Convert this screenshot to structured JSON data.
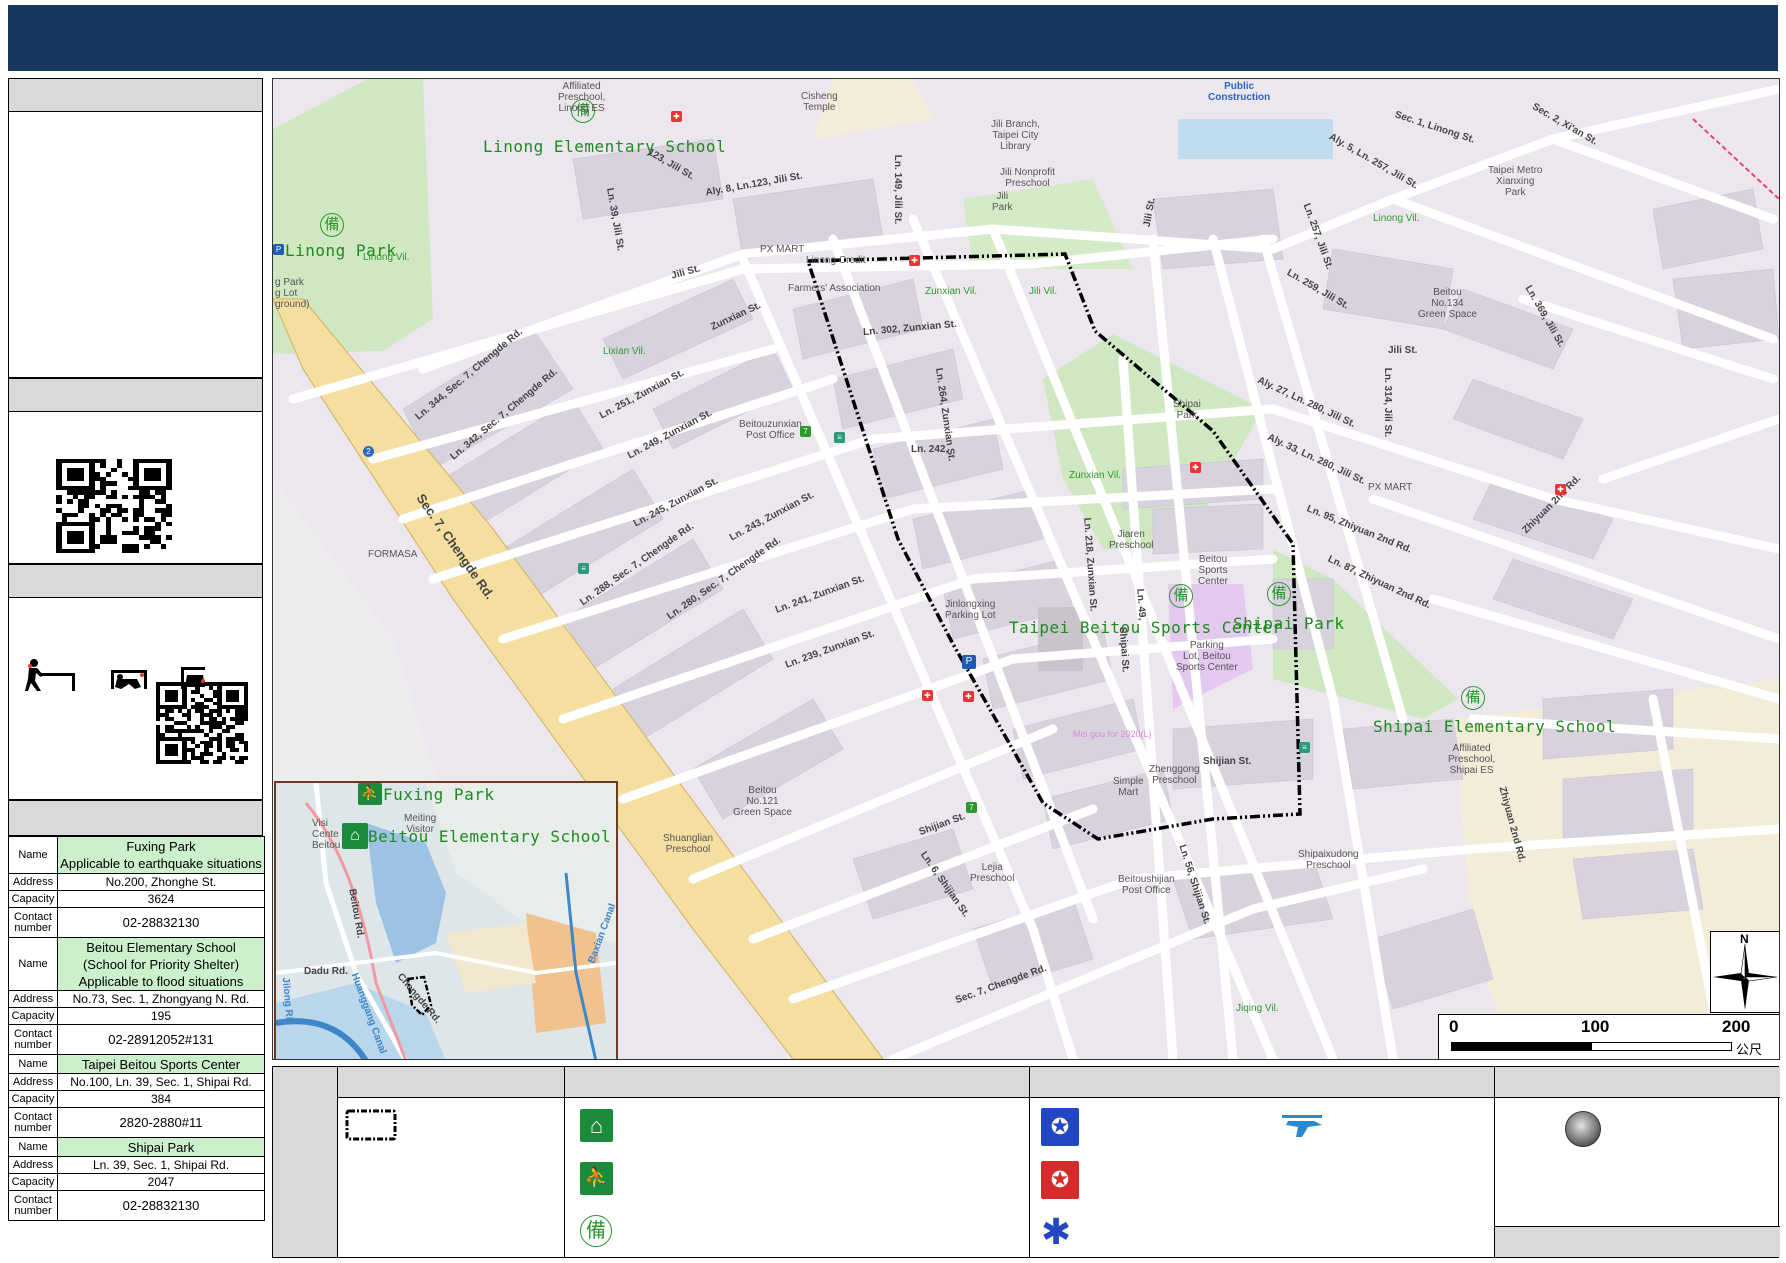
{
  "colors": {
    "header": "#17375e",
    "panel_head": "#d9d9d9",
    "shelter_name_bg": "#ccf0cc",
    "park": "#cfe8c2",
    "road": "#ffffff",
    "highway": "#f5dfa0",
    "route": "#000000"
  },
  "shelters": [
    {
      "name": [
        "Fuxing Park",
        "Applicable to earthquake situations"
      ],
      "address": "No.200, Zhonghe St.",
      "capacity": "3624",
      "contact": "02-28832130"
    },
    {
      "name": [
        "Beitou Elementary School",
        "(School for Priority Shelter)",
        "Applicable to flood situations"
      ],
      "address": "No.73, Sec. 1, Zhongyang N. Rd.",
      "capacity": "195",
      "contact": "02-28912052#131"
    },
    {
      "name": [
        "Taipei Beitou Sports Center"
      ],
      "address": "No.100, Ln. 39, Sec. 1, Shipai Rd.",
      "capacity": "384",
      "contact": "2820-2880#11"
    },
    {
      "name": [
        "Shipai Park"
      ],
      "address": "Ln. 39, Sec. 1, Shipai Rd.",
      "capacity": "2047",
      "contact": "02-28832130"
    }
  ],
  "shelter_labels": {
    "name": "Name",
    "address": "Address",
    "capacity": "Capacity",
    "contact1": "Contact",
    "contact2": "number"
  },
  "map": {
    "big_labels": {
      "linong_es": "Linong Elementary School",
      "linong_park": "Linong Park",
      "sports_center": "Taipei Beitou Sports Center",
      "shipai_park": "Shipai Park",
      "shipai_es": "Shipai Elementary School"
    },
    "villages": {
      "linong": "Linong Vil.",
      "linong2": "Linong Vil.",
      "lixian": "Lixian Vil.",
      "zunxian1": "Zunxian Vil.",
      "jili": "Jili Vil.",
      "zunxian2": "Zunxian Vil.",
      "jiqing": "Jiqing Vil."
    },
    "streets": {
      "sec1_linong": "Sec. 1, Linong St.",
      "sec2_xian": "Sec. 2, Xi'an St.",
      "aly5": "Aly. 5, Ln. 257, Jili St.",
      "ln257": "Ln. 257, Jili St.",
      "jili_st_top": "Jili St.",
      "ln123": "123, Jili St.",
      "aly8": "Aly. 8, Ln.123, Jili St.",
      "ln149": "Ln. 149, Jili St.",
      "ln39_jili": "Ln. 39, Jili St.",
      "jili_st": "Jili St.",
      "zunxian": "Zunxian St.",
      "ln302": "Ln. 302, Zunxian St.",
      "ln344": "Ln. 344, Sec. 7, Chengde Rd.",
      "ln342": "Ln. 342, Sec. 7, Chengde Rd.",
      "ln251": "Ln. 251, Zunxian St.",
      "ln249": "Ln. 249, Zunxian St.",
      "ln245": "Ln. 245, Zunxian St.",
      "ln243": "Ln. 243, Zunxian St.",
      "ln288": "Ln. 288, Sec. 7, Chengde Rd.",
      "ln280": "Ln. 280, Sec. 7, Chengde Rd.",
      "ln241": "Ln. 241, Zunxian St.",
      "ln239": "Ln. 239, Zunxian St.",
      "ln264": "Ln. 264, Zunxian St.",
      "ln242": "Ln.  242,",
      "ln218": "Ln. 218, Zunxian St.",
      "ln49": "Ln. 49,",
      "shipai_st": "Shipai St.",
      "chengde": "Sec. 7, Chengde Rd.",
      "chengde_bottom": "Sec. 7, Chengde Rd.",
      "shijian_st": "Shijian St.",
      "shijian_st2": "Shijian St.",
      "ln6_shijian": "Ln. 6, Shijian St.",
      "ln56": "Ln. 56, Shijian St.",
      "ln259": "Ln. 259, Jili St.",
      "jili_st_right": "Jili St.",
      "aly27": "Aly. 27, Ln. 280, Jili St.",
      "aly33": "Aly. 33, Ln. 280, Jili St.",
      "ln314": "Ln. 314, Jili St.",
      "ln95": "Ln. 95, Zhiyuan 2nd Rd.",
      "ln87": "Ln. 87, Zhiyuan 2nd Rd.",
      "zhiyuan": "Zhiyuan 2nd Rd.",
      "zhiyuan_right": "Zhiyuan 2nd Rd.",
      "ln369": "Ln. 369, Jili St."
    },
    "pois": {
      "affiliated": "Affiliated\nPreschool,\nLinong ES",
      "cisheng": "Cisheng\nTemple",
      "public": "Public\nConstruction",
      "jili_branch": "Jili Branch,\nTaipei City\nLibrary",
      "jili_nonprofit": "Jili Nonprofit\nPreschool",
      "jili_park": "Jili\nPark",
      "metro_park": "Taipei Metro\nXianxing\nPark",
      "pxmart": "PX MART",
      "linong_credit": "Linong Credit",
      "farmers": "Farmers' Association",
      "parking_l": "g Park\ng Lot\nground)",
      "post": "Beitouzunxian\nPost Office",
      "formasa": "FORMASA",
      "shipai_park_poi": "Shipai\nPark",
      "jiaren": "Jiaren\nPreschool",
      "sports_poi": "Beitou\nSports\nCenter",
      "parking_sports": "Parking\nLot, Beitou\nSports Center",
      "jinlong": "Jinlongxing\nParking Lot",
      "beitou121": "Beitou\nNo.121\nGreen Space",
      "shuanglian": "Shuanglian\nPreschool",
      "lejia": "Lejia\nPreschool",
      "simple": "Simple\nMart",
      "zhenggong": "Zhenggong\nPreschool",
      "beitoushijian": "Beitoushijian\nPost Office",
      "shipaixudong": "Shipaixudong\nPreschool",
      "affiliated_shipai": "Affiliated\nPreschool,\nShipai ES",
      "pxmart2": "PX MART",
      "beitou134": "Beitou\nNo.134\nGreen Space",
      "pink": "Mei gou for 2020(L)"
    },
    "inset": {
      "fuxing": "Fuxing Park",
      "beitou_es": "Beitou Elementary School",
      "meiting": "Meiting\nVisitor",
      "visitor": "Visi\nCente\nBeitou",
      "beitou_rd": "Beitou Rd.",
      "dadu": "Dadu Rd.",
      "baxian": "Baxian Canal",
      "chengde": "Chengde Rd.",
      "huangang": "Huanggang Canal",
      "river": "Jilong Ri"
    },
    "scale": {
      "zero": "0",
      "hundred": "100",
      "twohundred": "200",
      "unit": "公尺"
    },
    "north": "N"
  },
  "emblem_char": "備"
}
